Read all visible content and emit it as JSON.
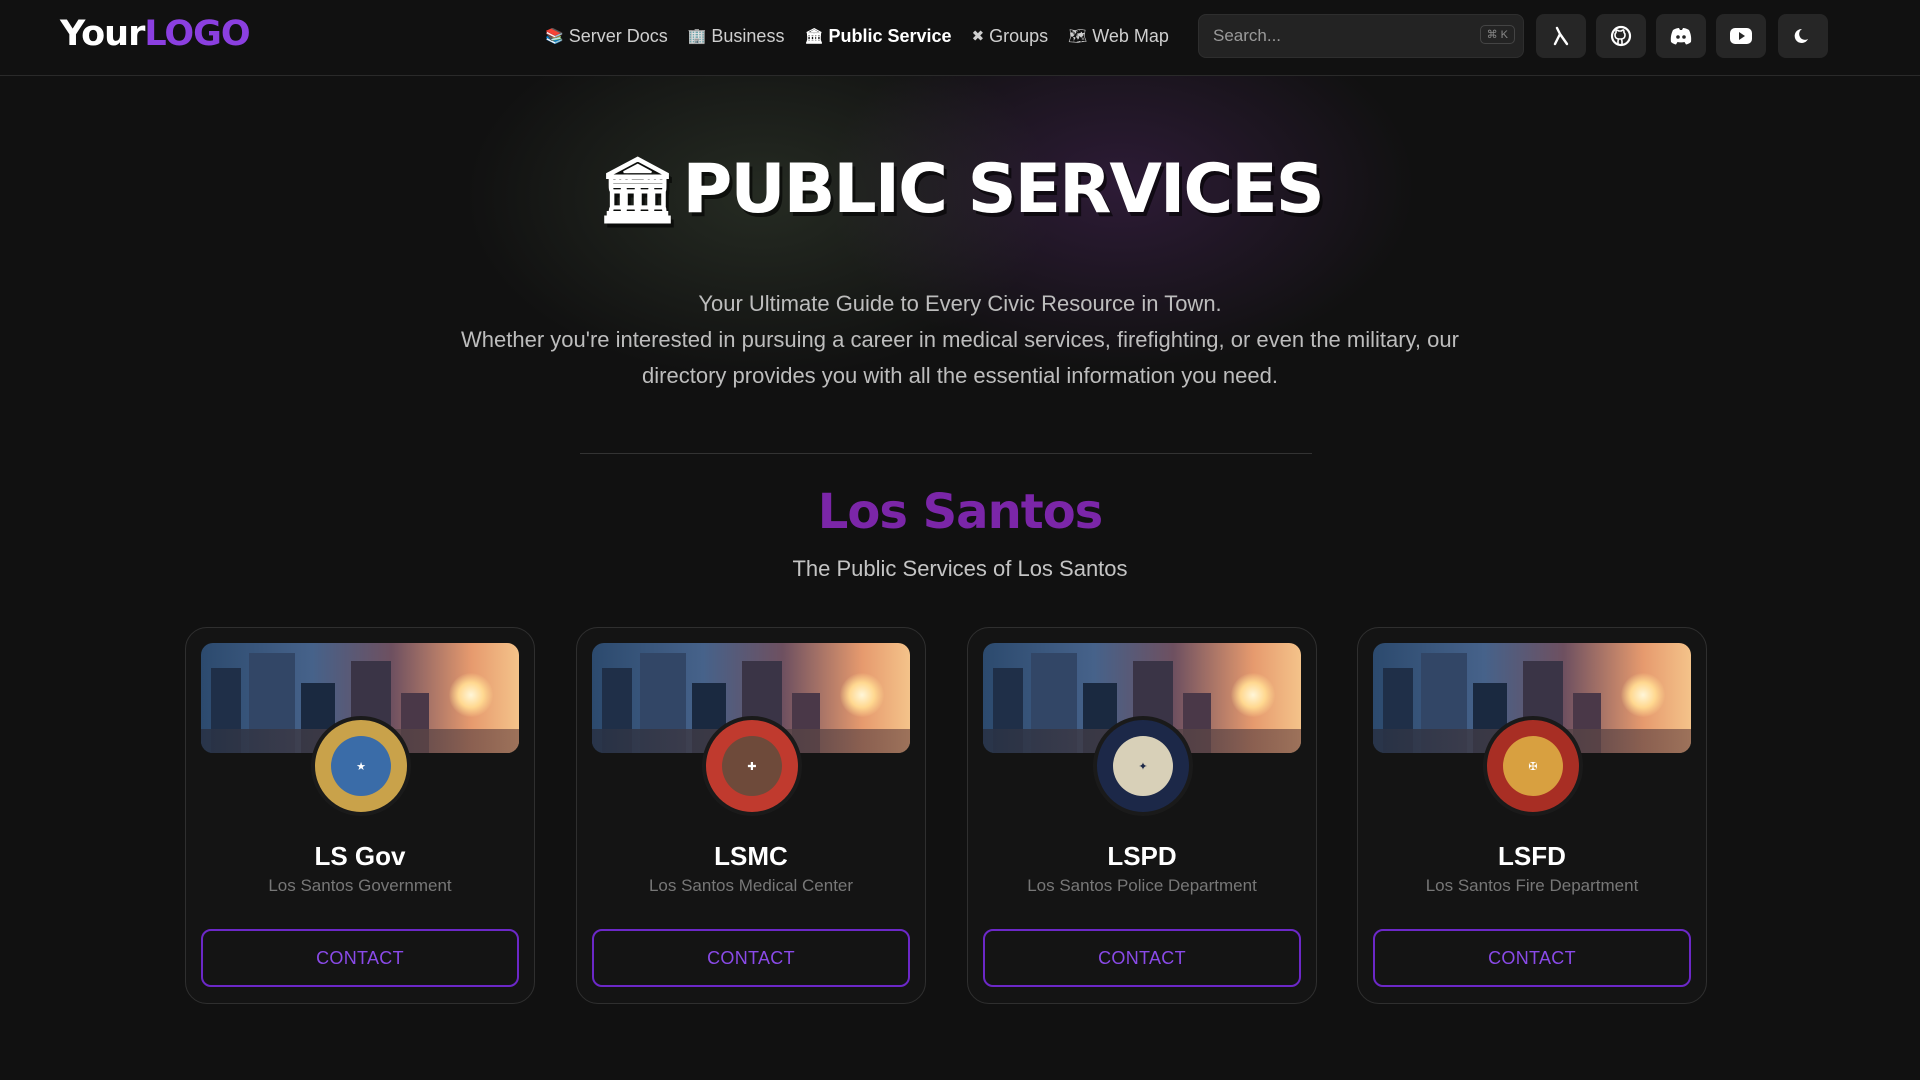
{
  "brand": {
    "logo_part1": "Your",
    "logo_part2": "LOGO"
  },
  "nav": {
    "links": [
      {
        "icon": "📚",
        "label": "Server Docs"
      },
      {
        "icon": "🏢",
        "label": "Business"
      },
      {
        "icon": "🏛",
        "label": "Public Service",
        "active": true
      },
      {
        "icon": "✖",
        "label": "Groups"
      },
      {
        "icon": "🗺",
        "label": "Web Map"
      }
    ],
    "search": {
      "placeholder": "Search...",
      "shortcut": "⌘ K"
    },
    "icon_buttons": [
      "lambda-icon",
      "github-icon",
      "discord-icon",
      "youtube-icon",
      "moon-icon"
    ]
  },
  "hero": {
    "emoji": "🏛",
    "title": "PUBLIC SERVICES",
    "subtitle_line1": "Your Ultimate Guide to Every Civic Resource in Town.",
    "subtitle_line2": "Whether you're interested in pursuing a career in medical services, firefighting, or even the military, our directory provides you with all the essential information you need."
  },
  "region": {
    "title": "Los Santos",
    "subtitle": "The Public Services of Los Santos"
  },
  "cards": [
    {
      "title": "LS Gov",
      "subtitle": "Los Santos Government",
      "button": "CONTACT",
      "seal_icon": "city-seal-icon",
      "seal_color": "#c9a24a",
      "seal_inner": "#3a6ca8"
    },
    {
      "title": "LSMC",
      "subtitle": "Los Santos Medical Center",
      "button": "CONTACT",
      "seal_icon": "medical-seal-icon",
      "seal_color": "#c03a2e",
      "seal_inner": "#6e4a3a"
    },
    {
      "title": "LSPD",
      "subtitle": "Los Santos Police Department",
      "button": "CONTACT",
      "seal_icon": "police-seal-icon",
      "seal_color": "#1c2848",
      "seal_inner": "#d8d0b8"
    },
    {
      "title": "LSFD",
      "subtitle": "Los Santos Fire Department",
      "button": "CONTACT",
      "seal_icon": "fire-seal-icon",
      "seal_color": "#a82e24",
      "seal_inner": "#d8a040"
    }
  ],
  "colors": {
    "accent": "#8b3fe0",
    "region_title": "#7b26a8",
    "background": "#111111"
  }
}
